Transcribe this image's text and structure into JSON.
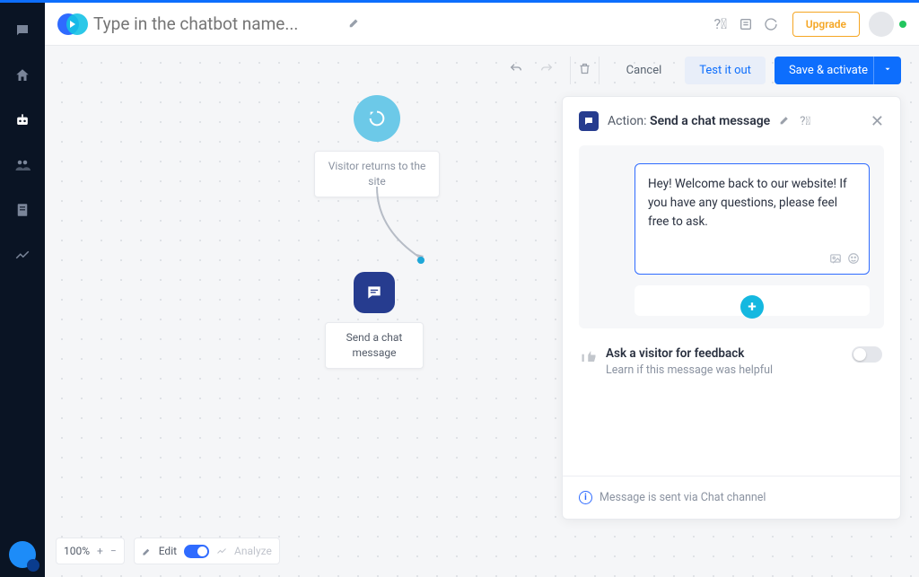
{
  "header": {
    "title_placeholder": "Type in the chatbot name...",
    "upgrade": "Upgrade"
  },
  "toolbar": {
    "cancel": "Cancel",
    "test": "Test it out",
    "save": "Save & activate"
  },
  "flow": {
    "trigger_label": "Visitor returns to the site",
    "action_label": "Send a chat message"
  },
  "panel": {
    "action_prefix": "Action: ",
    "action_name": "Send a chat message",
    "message": "Hey! Welcome back to our website! If you have any questions, please feel free to ask.",
    "feedback_title": "Ask a visitor for feedback",
    "feedback_sub": "Learn if this message was helpful",
    "note": "Message is sent via Chat channel"
  },
  "bottombar": {
    "zoom": "100%",
    "edit": "Edit",
    "analyze": "Analyze"
  }
}
